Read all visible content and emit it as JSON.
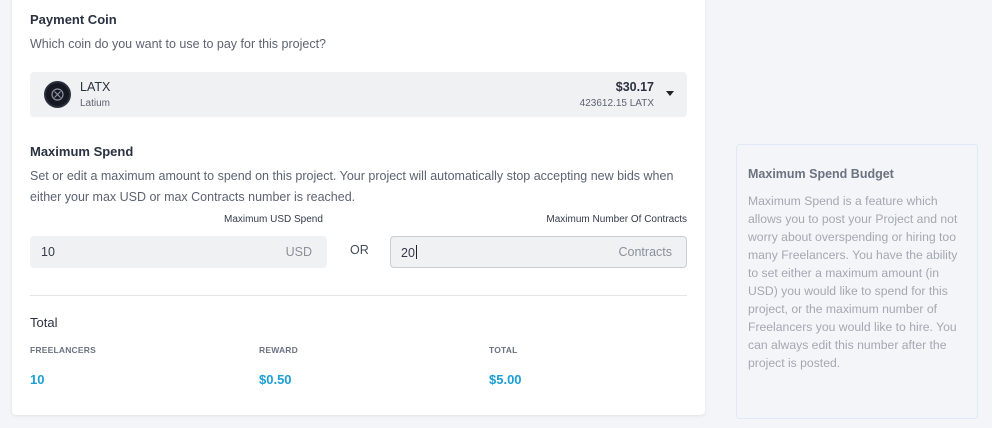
{
  "payment_coin": {
    "title": "Payment Coin",
    "question": "Which coin do you want to use to pay for this project?",
    "selected": {
      "symbol": "LATX",
      "name": "Latium",
      "usd_value": "$30.17",
      "amount": "423612.15 LATX",
      "icon": "latium-coin-icon"
    }
  },
  "maximum_spend": {
    "title": "Maximum Spend",
    "description": "Set or edit a maximum amount to spend on this project. Your project will automatically stop accepting new bids when either your max USD or max Contracts number is reached.",
    "usd_label": "Maximum USD Spend",
    "usd_value": "10",
    "usd_suffix": "USD",
    "or_label": "OR",
    "contracts_label": "Maximum Number Of Contracts",
    "contracts_value": "20",
    "contracts_suffix": "Contracts"
  },
  "total": {
    "title": "Total",
    "columns": [
      {
        "header": "FREELANCERS",
        "value": "10"
      },
      {
        "header": "REWARD",
        "value": "$0.50"
      },
      {
        "header": "TOTAL",
        "value": "$5.00"
      }
    ],
    "value_color": "#1b9fd6"
  },
  "info_panel": {
    "title": "Maximum Spend Budget",
    "body": "Maximum Spend is a feature which allows you to post your Project and not worry about overspending or hiring too many Freelancers. You have the ability to set either a maximum amount (in USD) you would like to spend for this project, or the maximum number of Freelancers you would like to hire. You can always edit this number after the project is posted."
  }
}
